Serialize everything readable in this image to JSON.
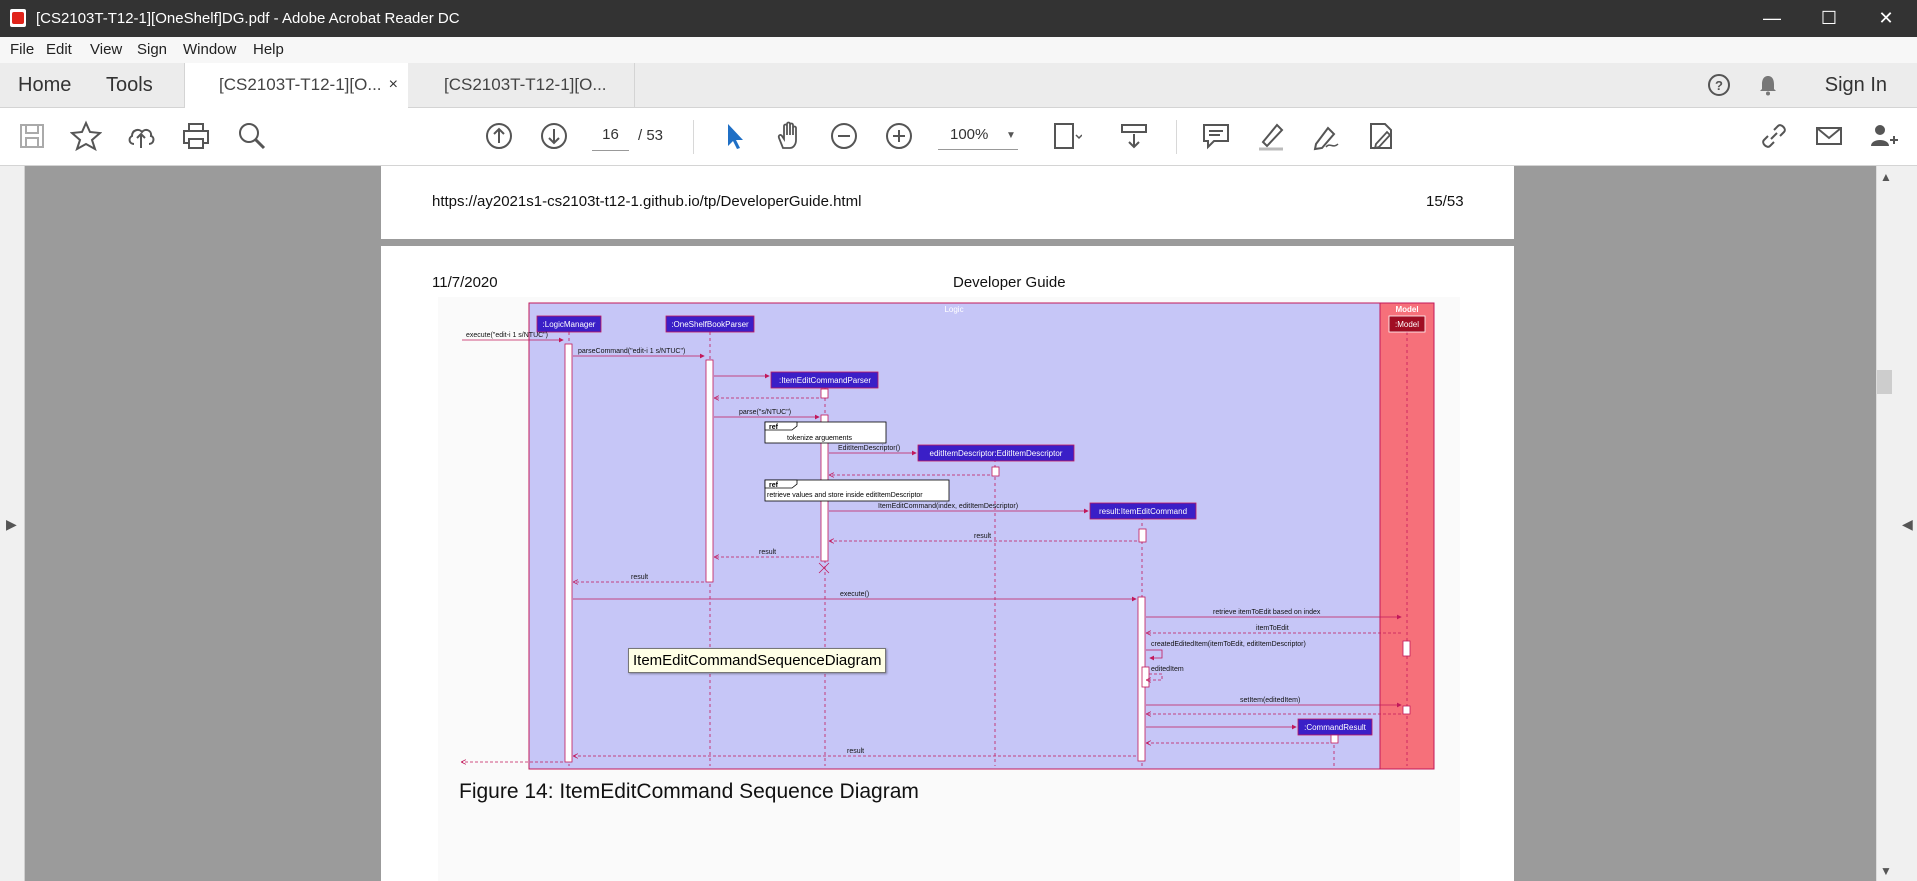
{
  "window": {
    "title": "[CS2103T-T12-1][OneShelf]DG.pdf - Adobe Acrobat Reader DC"
  },
  "menu": [
    "File",
    "Edit",
    "View",
    "Sign",
    "Window",
    "Help"
  ],
  "tabs": {
    "home": "Home",
    "tools": "Tools",
    "doc1": "[CS2103T-T12-1][O...",
    "doc2": "[CS2103T-T12-1][O...",
    "close": "×"
  },
  "header": {
    "sign_in": "Sign In"
  },
  "nav": {
    "current_page": "16",
    "page_total": "/ 53",
    "zoom": "100%"
  },
  "prev_page": {
    "url": "https://ay2021s1-cs2103t-t12-1.github.io/tp/DeveloperGuide.html",
    "page_num": "15/53"
  },
  "page": {
    "date": "11/7/2020",
    "title": "Developer Guide",
    "figure_caption": "Figure 14: ItemEditCommand Sequence Diagram"
  },
  "diagram": {
    "logic_label": "Logic",
    "model_label": "Model",
    "participants": {
      "logic_manager": ":LogicManager",
      "parser": ":OneShelfBookParser",
      "item_parser": ":ItemEditCommandParser",
      "descriptor": "editItemDescriptor:EditItemDescriptor",
      "command": "result:ItemEditCommand",
      "model": ":Model",
      "result": ":CommandResult"
    },
    "messages": {
      "execute_in": "execute(\"edit-i 1 s/NTUC\")",
      "parse_command": "parseCommand(\"edit-i 1 s/NTUC\")",
      "parse": "parse(\"s/NTUC\")",
      "edit_descriptor": "EditItemDescriptor()",
      "item_edit_command": "ItemEditCommand(index, editItemDescriptor)",
      "result": "result",
      "execute": "execute()",
      "retrieve": "retrieve itemToEdit based on index",
      "item_to_edit": "itemToEdit",
      "create_edited": "createdEditedItem(itemToEdit, editItemDescriptor)",
      "edited_item": "editedItem",
      "set_item": "setItem(editedItem)"
    },
    "refs": {
      "ref": "ref",
      "tokenize": "tokenize arguements",
      "retrieve_store": "retrieve values and store inside editItemDescriptor"
    }
  },
  "tooltip": "ItemEditCommandSequenceDiagram"
}
